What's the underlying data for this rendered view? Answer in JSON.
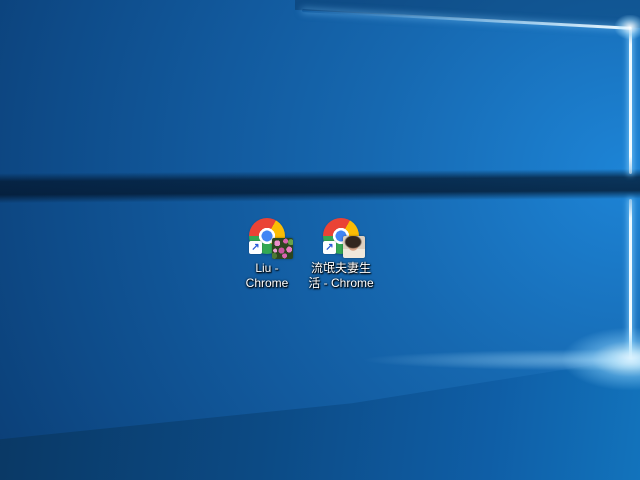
{
  "desktop": {
    "shortcut_arrow_glyph": "↗",
    "icons": [
      {
        "full_label": "Liu - Chrome",
        "label_line1": "Liu -",
        "label_line2": "Chrome",
        "badge": "flowers-photo"
      },
      {
        "full_label": "流氓夫妻生活 - Chrome",
        "label_line1": "流氓夫妻生",
        "label_line2": "活 - Chrome",
        "badge": "portrait-photo"
      }
    ],
    "colors": {
      "chrome_red": "#ea4335",
      "chrome_yellow": "#fbbc05",
      "chrome_green": "#34a853",
      "chrome_blue": "#4285f4",
      "wallpaper_dark": "#092f5e",
      "wallpaper_mid": "#0f5294",
      "wallpaper_bright": "#1d84d6",
      "wallpaper_band_dark": "#07284a",
      "beam_light": "#f2fbff"
    }
  }
}
